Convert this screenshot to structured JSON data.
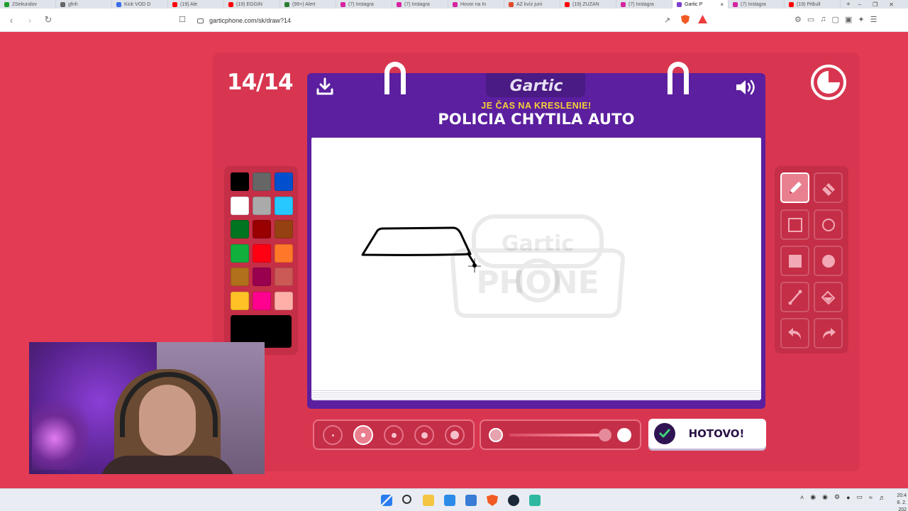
{
  "browser": {
    "tabs": [
      {
        "title": "2Sekundov",
        "color": "#1b9e2b"
      },
      {
        "title": "gfnh",
        "color": "#666666"
      },
      {
        "title": "Kick VOD D",
        "color": "#3b6ee8"
      },
      {
        "title": "(19) Ale",
        "color": "#ff0000"
      },
      {
        "title": "(19) EGGIN",
        "color": "#ff0000"
      },
      {
        "title": "(99+) Alert",
        "color": "#2a7d2e"
      },
      {
        "title": "(7) Instagra",
        "color": "#d6249f"
      },
      {
        "title": "(7) Instagra",
        "color": "#d6249f"
      },
      {
        "title": "Hovor na In",
        "color": "#d6249f"
      },
      {
        "title": "AZ kvíz juni",
        "color": "#e04a2b"
      },
      {
        "title": "(19) ZUZAN",
        "color": "#ff0000"
      },
      {
        "title": "(7) Instagra",
        "color": "#d6249f"
      },
      {
        "title": "Gartic P",
        "color": "#7b3fcf"
      },
      {
        "title": "(7) Instagra",
        "color": "#d6249f"
      },
      {
        "title": "(19) Pitbull",
        "color": "#ff0000"
      }
    ],
    "new_tab": "+",
    "url": "garticphone.com/sk/draw?14"
  },
  "game": {
    "round": "14/14",
    "logo": "Gartic",
    "subtitle": "JE ČAS NA KRESLENIE!",
    "prompt": "POLICIA CHYTILA AUTO",
    "watermark_line1": "Gartic",
    "watermark_line2": "PHONE",
    "done_label": "HOTOVO!",
    "palette": [
      "#000000",
      "#666666",
      "#0050cd",
      "#ffffff",
      "#aaaaaa",
      "#26c9ff",
      "#017420",
      "#990000",
      "#964112",
      "#11b03c",
      "#ff0013",
      "#ff7829",
      "#b0701c",
      "#99004e",
      "#cb5a57",
      "#ffc126",
      "#ff008f",
      "#feafa8"
    ],
    "current_color": "#000000",
    "tools": [
      "pen",
      "eraser",
      "rectangle-outline",
      "ellipse-outline",
      "rectangle-filled",
      "ellipse-filled",
      "line",
      "fill-bucket",
      "undo",
      "redo"
    ],
    "selected_tool": "pen",
    "brush_sizes": 5,
    "selected_brush_index": 1,
    "opacity_percent": 100
  },
  "taskbar": {
    "clock_time": "20:4",
    "clock_date": "8. 2. 202"
  }
}
